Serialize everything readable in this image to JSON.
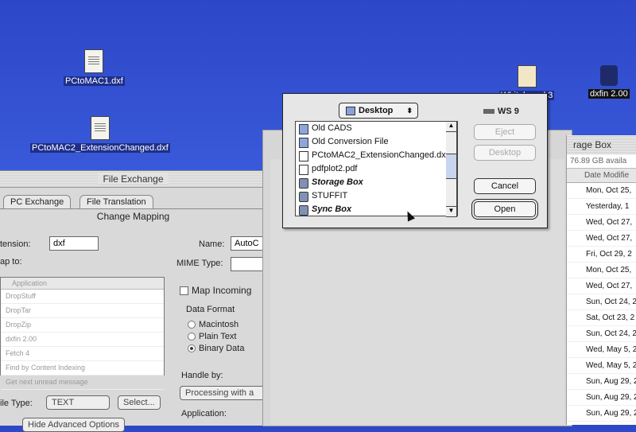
{
  "desktop": {
    "icons": [
      {
        "label": "PCtoMAC1.dxf"
      },
      {
        "label": "PCtoMAC2_ExtensionChanged.dxf"
      },
      {
        "label": "Whiteboard 3"
      },
      {
        "label": "dxfin 2.00"
      }
    ]
  },
  "file_exchange": {
    "title": "File Exchange",
    "tabs": [
      "PC Exchange",
      "File Translation"
    ],
    "section_title": "Change Mapping",
    "extension_label": "tension:",
    "extension_value": "dxf",
    "map_to_label": "ap to:",
    "list_header": "Application",
    "list_items": [
      "DropStuff",
      "DropTar",
      "DropZip",
      "dxfin 2.00",
      "Fetch 4",
      "Find by Content Indexing",
      "Get next unread message"
    ],
    "file_type_label": "ile Type:",
    "file_type_value": "TEXT",
    "select_button": "Select...",
    "hide_button": "Hide Advanced Options",
    "name_label": "Name:",
    "name_value": "AutoC",
    "mime_label": "MIME Type:",
    "map_incoming": "Map Incoming",
    "data_format_label": "Data Format",
    "formats": [
      "Macintosh",
      "Plain Text",
      "Binary Data"
    ],
    "handle_by_label": "Handle by:",
    "handle_by_value": "Processing with a",
    "application_label": "Application:"
  },
  "storage_box": {
    "title": "rage Box",
    "available": "76.89 GB availa",
    "column_header": "Date Modifie",
    "dates": [
      "Mon, Oct 25,",
      "Yesterday, 1",
      "Wed, Oct 27,",
      "Wed, Oct 27,",
      "Fri, Oct 29, 2",
      "Mon, Oct 25,",
      "Wed, Oct 27,",
      "Sun, Oct 24, 2",
      "Sat, Oct 23, 2",
      "Sun, Oct 24, 2",
      "Wed, May 5, 2",
      "Wed, May 5, 2",
      "Sun, Aug 29, 2",
      "Sun, Aug 29, 2",
      "Sun, Aug 29, 2"
    ]
  },
  "open_dialog": {
    "location": "Desktop",
    "volume": "WS 9",
    "files": [
      {
        "name": "Old CADS",
        "kind": "folder",
        "italic": false
      },
      {
        "name": "Old Conversion File",
        "kind": "folder",
        "italic": false
      },
      {
        "name": "PCtoMAC2_ExtensionChanged.dxf",
        "kind": "doc",
        "italic": false
      },
      {
        "name": "pdfplot2.pdf",
        "kind": "doc",
        "italic": false
      },
      {
        "name": "Storage Box",
        "kind": "disk",
        "italic": true
      },
      {
        "name": "STUFFIT",
        "kind": "disk",
        "italic": false
      },
      {
        "name": "Sync Box",
        "kind": "disk",
        "italic": true
      }
    ],
    "buttons": {
      "eject": "Eject",
      "desktop": "Desktop",
      "cancel": "Cancel",
      "open": "Open"
    }
  }
}
